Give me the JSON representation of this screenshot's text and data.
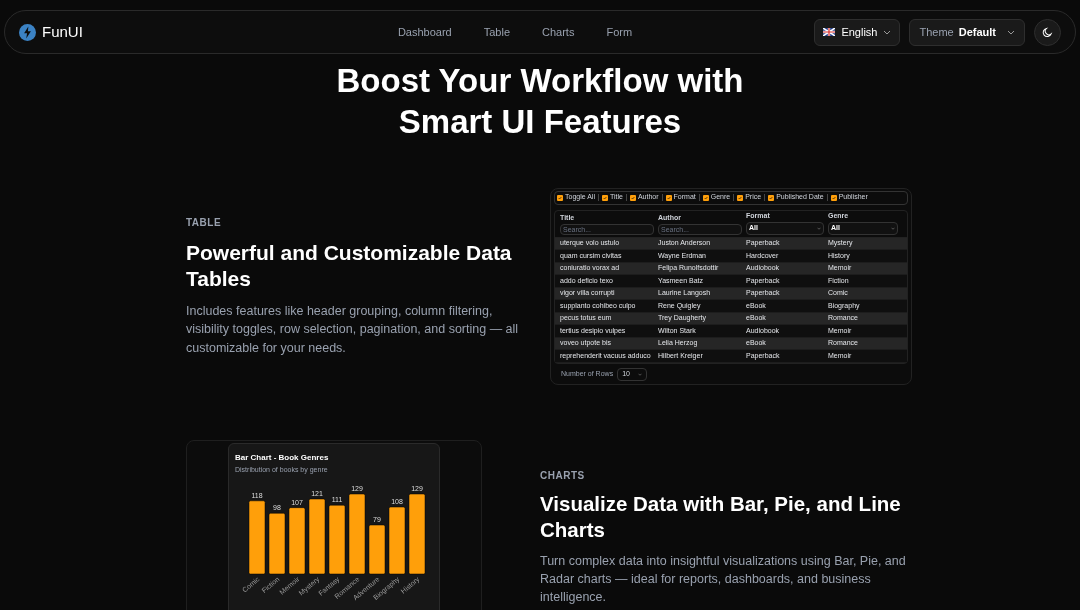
{
  "navbar": {
    "brand": "FunUI",
    "links": [
      {
        "label": "Dashboard",
        "selected": false
      },
      {
        "label": "Table",
        "selected": false
      },
      {
        "label": "Charts",
        "selected": false
      },
      {
        "label": "Form",
        "selected": false
      }
    ],
    "language": "English",
    "theme_label": "Theme",
    "theme_value": "Default"
  },
  "hero": {
    "title": "Boost Your Workflow with Smart UI Features"
  },
  "table_section": {
    "eyebrow": "TABLE",
    "title": "Powerful and Customizable Data Tables",
    "description": "Includes features like header grouping, column filtering, visibility toggles, row selection, pagination, and sorting — all customizable for your needs.",
    "preview": {
      "toggles": [
        {
          "label": "Toggle All",
          "checked": true
        },
        {
          "label": "Title",
          "checked": true
        },
        {
          "label": "Author",
          "checked": true
        },
        {
          "label": "Format",
          "checked": true
        },
        {
          "label": "Genre",
          "checked": true
        },
        {
          "label": "Price",
          "checked": true
        },
        {
          "label": "Published Date",
          "checked": true
        },
        {
          "label": "Publisher",
          "checked": true
        }
      ],
      "columns": [
        {
          "label": "Title",
          "kind": "search",
          "placeholder": "Search..."
        },
        {
          "label": "Author",
          "kind": "search",
          "placeholder": "Search..."
        },
        {
          "label": "Format",
          "kind": "select",
          "value": "All"
        },
        {
          "label": "Genre",
          "kind": "select",
          "value": "All"
        }
      ],
      "rows": [
        [
          "uterque volo ustulo",
          "Juston Anderson",
          "Paperback",
          "Mystery"
        ],
        [
          "quam cursim civitas",
          "Wayne Erdman",
          "Hardcover",
          "History"
        ],
        [
          "coniuratio vorax ad",
          "Felipa Runolfsdottir",
          "Audiobook",
          "Memoir"
        ],
        [
          "addo deficio texo",
          "Yasmeen Batz",
          "Paperback",
          "Fiction"
        ],
        [
          "vigor villa corrupti",
          "Laurine Langosh",
          "Paperback",
          "Comic"
        ],
        [
          "supplanto cohibeo culpo",
          "Rene Quigley",
          "eBook",
          "Biography"
        ],
        [
          "pecus totus eum",
          "Trey Daugherty",
          "eBook",
          "Romance"
        ],
        [
          "tertius desipio vulpes",
          "Wilton Stark",
          "Audiobook",
          "Memoir"
        ],
        [
          "voveo utpote bis",
          "Lelia Herzog",
          "eBook",
          "Romance"
        ],
        [
          "reprehenderit vacuus adduco",
          "Hilbert Kreiger",
          "Paperback",
          "Memoir"
        ]
      ],
      "rows_label": "Number of Rows",
      "rows_value": "10"
    }
  },
  "charts_section": {
    "eyebrow": "CHARTS",
    "title": "Visualize Data with Bar, Pie, and Line Charts",
    "description": "Turn complex data into insightful visualizations using Bar, Pie, and Radar charts — ideal for reports, dashboards, and business intelligence.",
    "chart_title": "Bar Chart - Book Genres",
    "chart_subtitle": "Distribution of books by genre",
    "chart_data": {
      "type": "bar",
      "categories": [
        "Comic",
        "Fiction",
        "Memoir",
        "Mystery",
        "Fantasy",
        "Romance",
        "Adventure",
        "Biography",
        "History"
      ],
      "values": [
        118,
        98,
        107,
        121,
        111,
        129,
        79,
        108,
        129
      ],
      "data_labels": true
    }
  }
}
